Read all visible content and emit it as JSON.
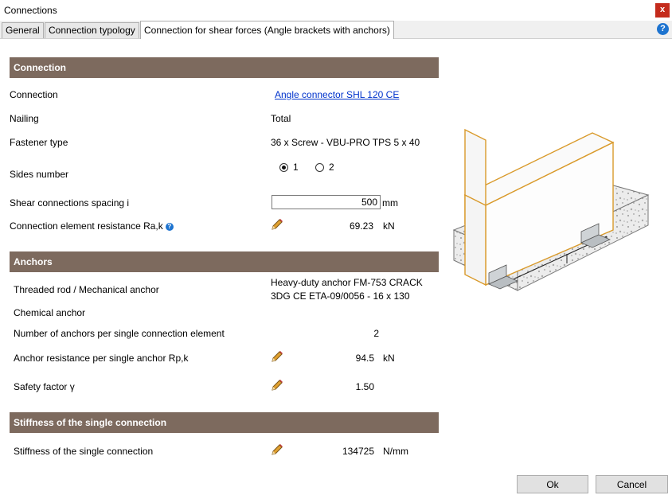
{
  "window": {
    "title": "Connections",
    "close_label": "x"
  },
  "tabs": [
    {
      "label": "General"
    },
    {
      "label": "Connection typology"
    },
    {
      "label": "Connection for shear forces (Angle brackets with anchors)"
    }
  ],
  "help_label": "?",
  "connection": {
    "header": "Connection",
    "connection_label": "Connection",
    "connection_value": "Angle connector SHL 120 CE",
    "nailing_label": "Nailing",
    "nailing_value": "Total",
    "fastener_label": "Fastener type",
    "fastener_value": "36  x  Screw - VBU-PRO TPS 5 x 40",
    "sides_label": "Sides number",
    "sides_options": [
      "1",
      "2"
    ],
    "sides_selected": "1",
    "spacing_label": "Shear connections spacing i",
    "spacing_value": "500",
    "spacing_unit": "mm",
    "resistance_label": "Connection element resistance Ra,k",
    "resistance_value": "69.23",
    "resistance_unit": "kN"
  },
  "anchors": {
    "header": "Anchors",
    "threaded_label": "Threaded rod / Mechanical anchor",
    "threaded_value_line1": "Heavy-duty anchor FM-753 CRACK",
    "threaded_value_line2": "3DG CE ETA-09/0056 - 16 x 130",
    "chemical_label": "Chemical anchor",
    "count_label": "Number of anchors per single connection element",
    "count_value": "2",
    "anchor_res_label": "Anchor resistance per single anchor Rp,k",
    "anchor_res_value": "94.5",
    "anchor_res_unit": "kN",
    "safety_label": "Safety factor γ",
    "safety_value": "1.50"
  },
  "stiffness": {
    "header": "Stiffness of the single connection",
    "label": "Stiffness of the single connection",
    "value": "134725",
    "unit": "N/mm"
  },
  "buttons": {
    "ok": "Ok",
    "cancel": "Cancel"
  },
  "colors": {
    "section_header": "#7d6a5e",
    "link": "#0033cc",
    "timber_outline": "#d99a2b",
    "close": "#c42b1c"
  }
}
